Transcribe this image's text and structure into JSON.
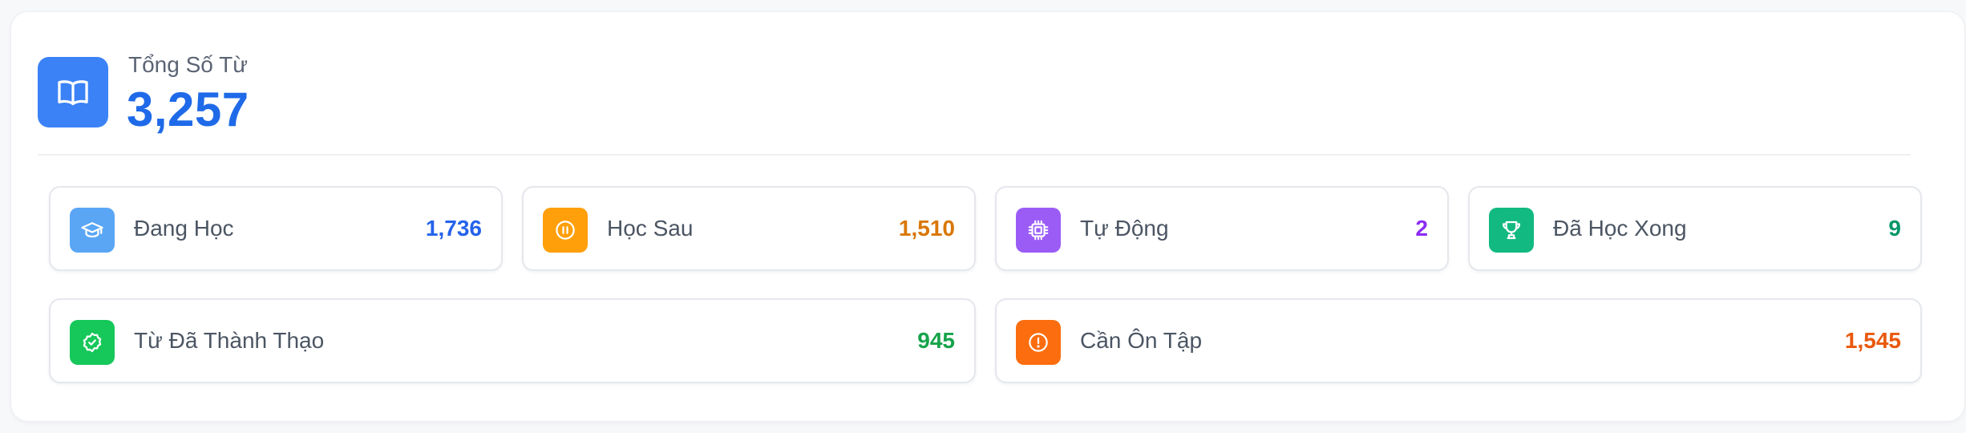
{
  "summary": {
    "label": "Tổng Số Từ",
    "value": "3,257",
    "icon": "book-open-icon",
    "color": "#3b82f6"
  },
  "stats": [
    {
      "label": "Đang Học",
      "value": "1,736",
      "icon": "graduation-cap-icon",
      "icon_bg": "#5aa6f5",
      "value_color": "#2563eb"
    },
    {
      "label": "Học Sau",
      "value": "1,510",
      "icon": "pause-circle-icon",
      "icon_bg": "#ff9f0a",
      "value_color": "#d97706"
    },
    {
      "label": "Tự Động",
      "value": "2",
      "icon": "cpu-chip-icon",
      "icon_bg": "#9b5cf6",
      "value_color": "#8b2cf5"
    },
    {
      "label": "Đã Học Xong",
      "value": "9",
      "icon": "trophy-icon",
      "icon_bg": "#12b981",
      "value_color": "#059669"
    },
    {
      "label": "Từ Đã Thành Thạo",
      "value": "945",
      "icon": "check-badge-icon",
      "icon_bg": "#16c75a",
      "value_color": "#16a34a"
    },
    {
      "label": "Cần Ôn Tập",
      "value": "1,545",
      "icon": "alert-circle-icon",
      "icon_bg": "#fb6d0f",
      "value_color": "#ea580c"
    }
  ]
}
